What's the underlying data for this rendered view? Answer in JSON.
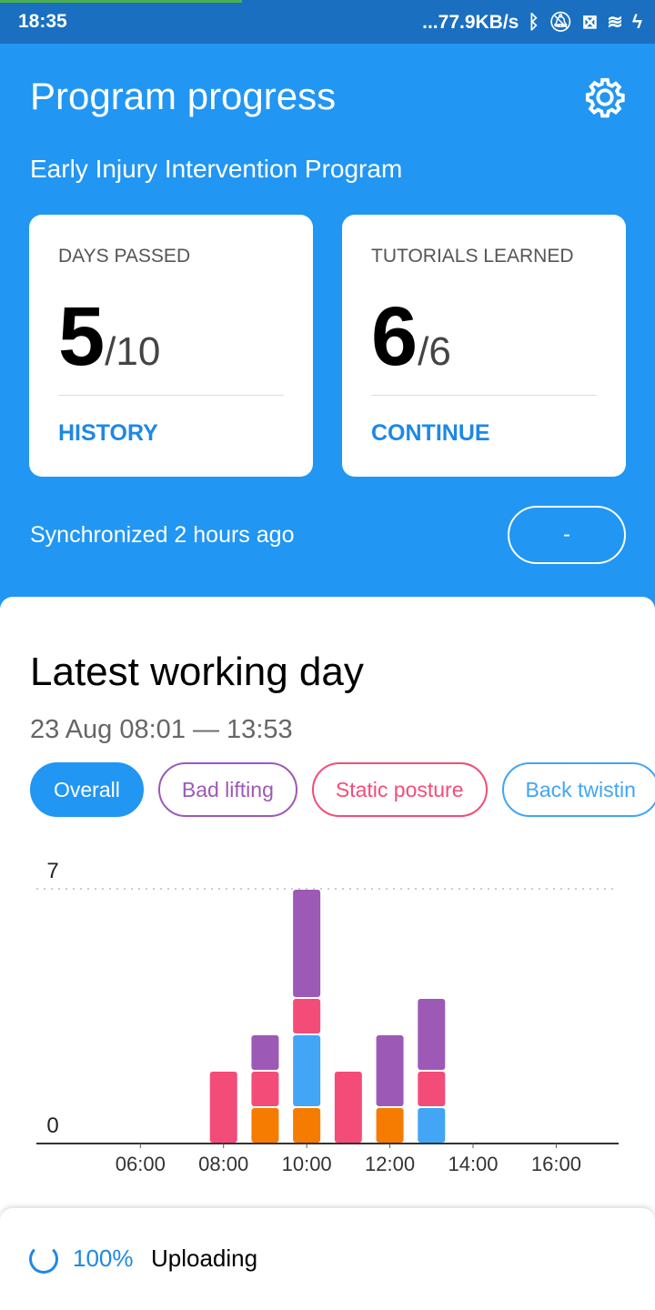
{
  "status_bar": {
    "time": "18:35",
    "network_speed": "...77.9KB/s",
    "icons": [
      "bluetooth-icon",
      "bell-off-icon",
      "sim-x-icon",
      "wifi-icon",
      "charging-icon"
    ]
  },
  "header": {
    "title": "Program progress",
    "subtitle": "Early Injury Intervention Program",
    "cards": [
      {
        "label": "DAYS PASSED",
        "value": "5",
        "total": "/10",
        "link": "HISTORY"
      },
      {
        "label": "TUTORIALS LEARNED",
        "value": "6",
        "total": "/6",
        "link": "CONTINUE"
      }
    ],
    "sync_text": "Synchronized 2 hours ago",
    "sync_button": "-"
  },
  "day": {
    "title": "Latest working day",
    "range": "23 Aug 08:01 — 13:53",
    "chips": [
      {
        "label": "Overall",
        "color": "#2196f3",
        "active": true
      },
      {
        "label": "Bad lifting",
        "color": "#9c59b6"
      },
      {
        "label": "Static posture",
        "color": "#f44c78"
      },
      {
        "label": "Back twistin",
        "color": "#42a5f5"
      }
    ]
  },
  "chart_data": {
    "type": "bar",
    "stacked": true,
    "ylim": [
      0,
      7
    ],
    "yticks": [
      "0",
      "7"
    ],
    "xlim": [
      3.5,
      17.5
    ],
    "xticks": [
      {
        "x": 6,
        "label": "06:00"
      },
      {
        "x": 8,
        "label": "08:00"
      },
      {
        "x": 10,
        "label": "10:00"
      },
      {
        "x": 12,
        "label": "12:00"
      },
      {
        "x": 14,
        "label": "14:00"
      },
      {
        "x": 16,
        "label": "16:00"
      }
    ],
    "x": [
      8,
      9,
      10,
      11,
      12,
      13
    ],
    "series": [
      {
        "color": "#f57c00",
        "values": [
          0,
          1,
          1,
          0,
          1,
          0
        ]
      },
      {
        "color": "#42a5f5",
        "values": [
          0,
          0,
          2,
          0,
          0,
          1
        ]
      },
      {
        "color": "#f44c78",
        "values": [
          2,
          1,
          1,
          2,
          0,
          1
        ]
      },
      {
        "color": "#9c59b6",
        "values": [
          0,
          1,
          3,
          0,
          2,
          2
        ]
      }
    ],
    "grid": "dotted line at max"
  },
  "upload": {
    "percent": "100%",
    "label": "Uploading"
  }
}
